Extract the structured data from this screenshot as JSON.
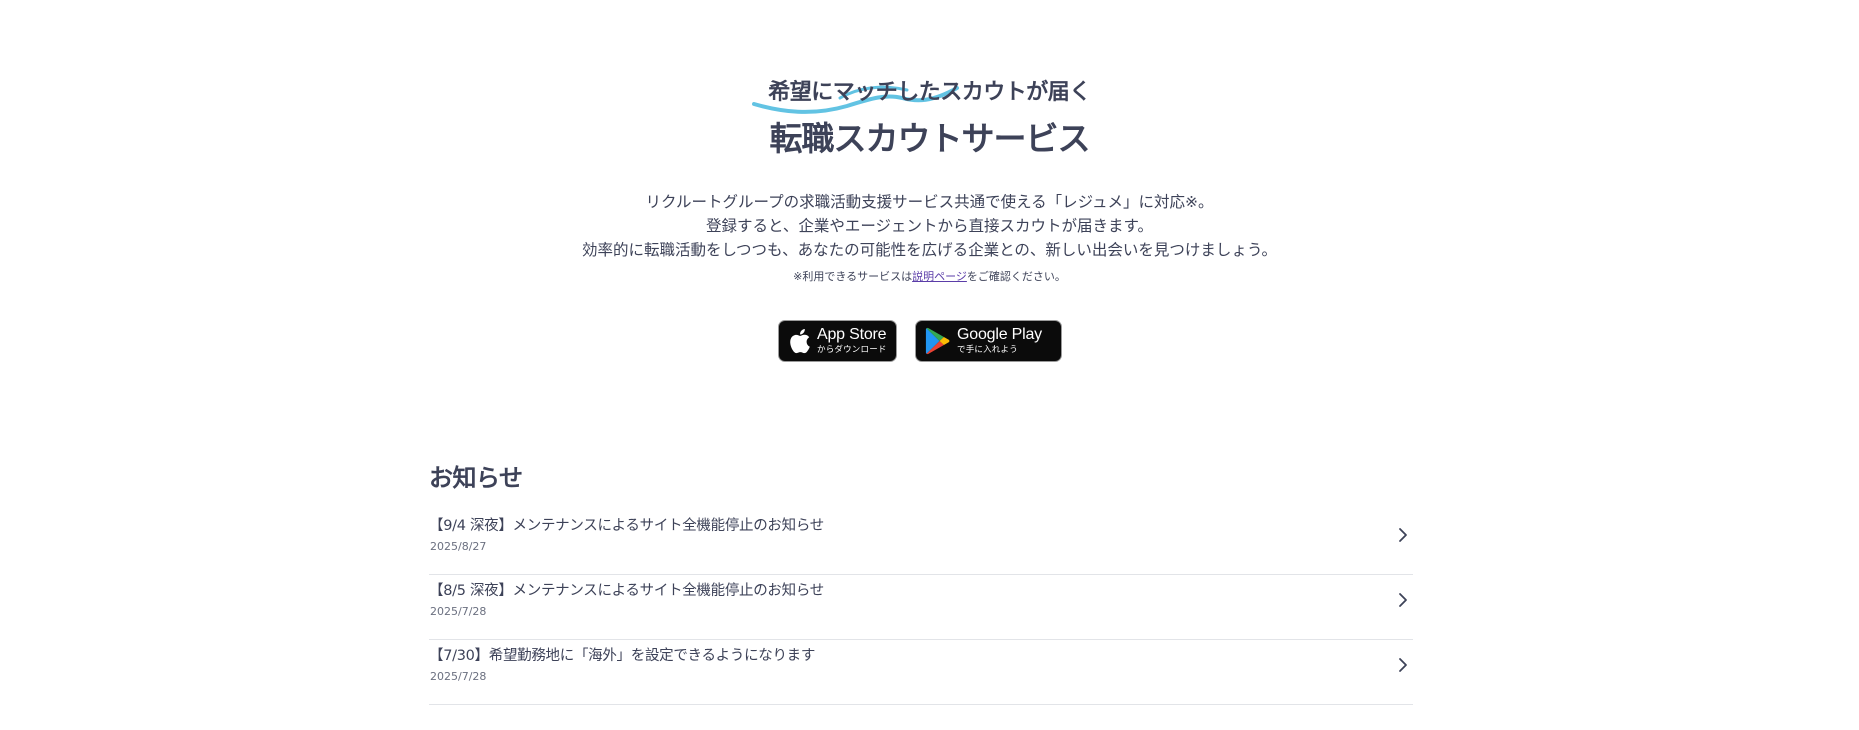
{
  "hero": {
    "tagline": "希望にマッチしたスカウトが届く",
    "title": "転職スカウトサービス",
    "description_lines": [
      "リクルートグループの求職活動支援サービス共通で使える「レジュメ」に対応※。",
      "登録すると、企業やエージェントから直接スカウトが届きます。",
      "効率的に転職活動をしつつも、あなたの可能性を広げる企業との、新しい出会いを見つけましょう。"
    ],
    "note_prefix": "※利用できるサービスは",
    "note_link": "説明ページ",
    "note_suffix": "をご確認ください。",
    "accent_color": "#5bc0de"
  },
  "stores": {
    "app_store": {
      "main": "App Store",
      "sub": "からダウンロード",
      "icon": "apple-icon"
    },
    "google_play": {
      "main": "Google Play",
      "sub": "で手に入れよう",
      "icon": "google-play-icon"
    }
  },
  "news": {
    "heading": "お知らせ",
    "items": [
      {
        "title": "【9/4 深夜】メンテナンスによるサイト全機能停止のお知らせ",
        "date": "2025/8/27"
      },
      {
        "title": "【8/5 深夜】メンテナンスによるサイト全機能停止のお知らせ",
        "date": "2025/7/28"
      },
      {
        "title": "【7/30】希望勤務地に「海外」を設定できるようになります",
        "date": "2025/7/28"
      }
    ]
  }
}
